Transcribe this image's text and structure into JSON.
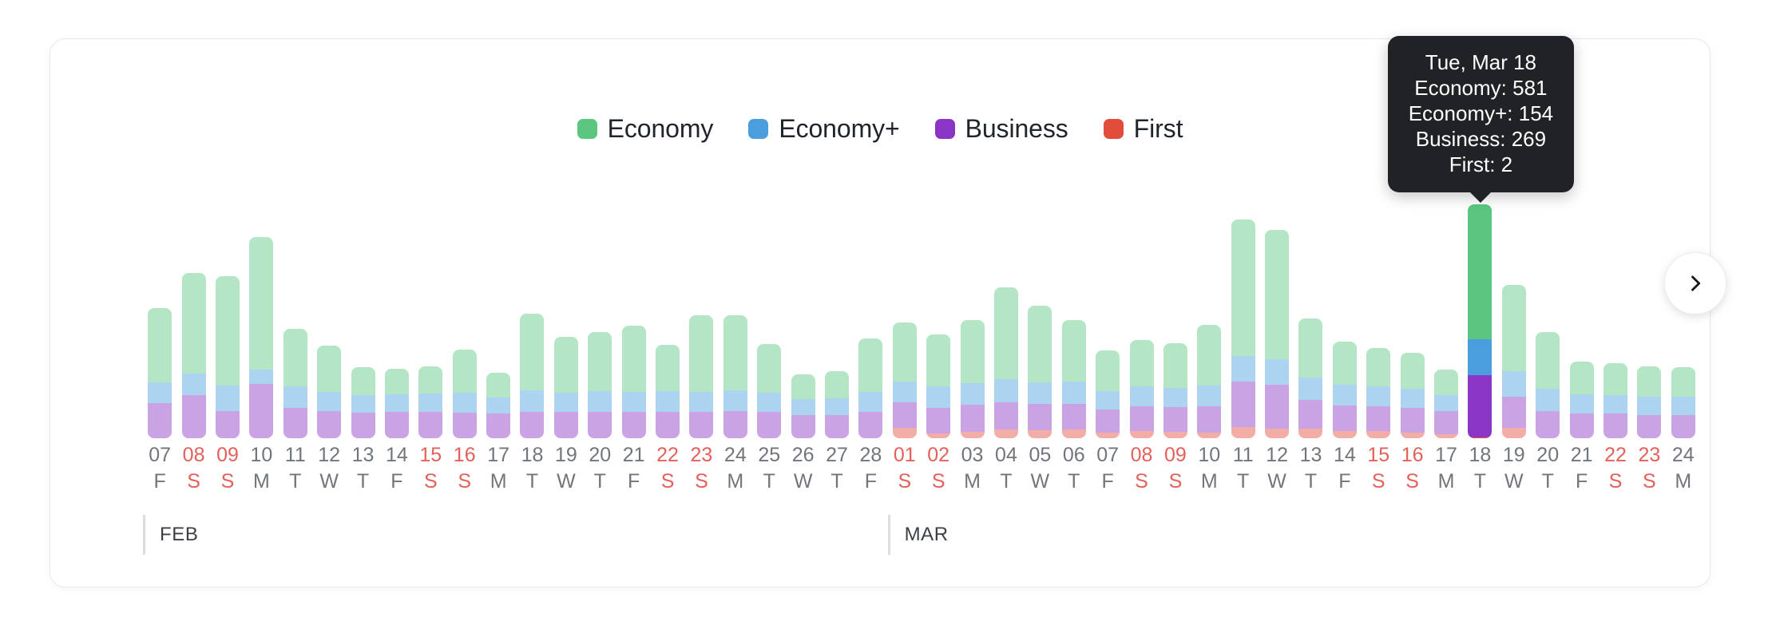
{
  "colors": {
    "economy": "#5bc67f",
    "economy_plus": "#4a9ede",
    "business": "#8b35c4",
    "first": "#e24c3b",
    "tooltip_bg": "#202226",
    "weekend_text": "#e4605a",
    "weekday_text": "#71757c",
    "card_bg": "#ffffff"
  },
  "legend": {
    "items": [
      {
        "label": "Economy",
        "color": "#5bc67f",
        "key": "economy"
      },
      {
        "label": "Economy+",
        "color": "#4a9ede",
        "key": "economy_plus"
      },
      {
        "label": "Business",
        "color": "#8b35c4",
        "key": "business"
      },
      {
        "label": "First",
        "color": "#e24c3b",
        "key": "first"
      }
    ]
  },
  "tooltip": {
    "date": "Tue, Mar 18",
    "rows": [
      "Economy: 581",
      "Economy+: 154",
      "Business: 269",
      "First: 2"
    ],
    "highlight_index": 39
  },
  "next_button": {
    "icon": "chevron-right-icon",
    "label": "Next"
  },
  "months": [
    {
      "label": "FEB",
      "start_index": 0,
      "span": 22
    },
    {
      "label": "MAR",
      "start_index": 22,
      "span": 24
    }
  ],
  "chart_data": {
    "type": "bar",
    "stacked": true,
    "title": "",
    "xlabel": "",
    "ylabel": "",
    "legend_position": "top-center",
    "grid": false,
    "series": [
      {
        "name": "Economy",
        "key": "economy",
        "color": "#5bc67f"
      },
      {
        "name": "Economy+",
        "key": "economy_plus",
        "color": "#4a9ede"
      },
      {
        "name": "Business",
        "key": "business",
        "color": "#8b35c4"
      },
      {
        "name": "First",
        "key": "first",
        "color": "#e24c3b"
      }
    ],
    "ymax": 1100,
    "categories": [
      {
        "day": "07",
        "dow": "F",
        "month": "FEB",
        "weekend": false,
        "economy": 322,
        "economy_plus": 90,
        "business": 150,
        "first": 0
      },
      {
        "day": "08",
        "dow": "S",
        "month": "FEB",
        "weekend": true,
        "economy": 430,
        "economy_plus": 95,
        "business": 185,
        "first": 0
      },
      {
        "day": "09",
        "dow": "S",
        "month": "FEB",
        "weekend": true,
        "economy": 470,
        "economy_plus": 110,
        "business": 118,
        "first": 0
      },
      {
        "day": "10",
        "dow": "M",
        "month": "FEB",
        "weekend": false,
        "economy": 570,
        "economy_plus": 60,
        "business": 235,
        "first": 0
      },
      {
        "day": "11",
        "dow": "T",
        "month": "FEB",
        "weekend": false,
        "economy": 245,
        "economy_plus": 95,
        "business": 130,
        "first": 0
      },
      {
        "day": "12",
        "dow": "W",
        "month": "FEB",
        "weekend": false,
        "economy": 200,
        "economy_plus": 80,
        "business": 118,
        "first": 0
      },
      {
        "day": "13",
        "dow": "T",
        "month": "FEB",
        "weekend": false,
        "economy": 120,
        "economy_plus": 75,
        "business": 110,
        "first": 0
      },
      {
        "day": "14",
        "dow": "F",
        "month": "FEB",
        "weekend": false,
        "economy": 110,
        "economy_plus": 78,
        "business": 112,
        "first": 0
      },
      {
        "day": "15",
        "dow": "S",
        "month": "FEB",
        "weekend": true,
        "economy": 118,
        "economy_plus": 80,
        "business": 112,
        "first": 0
      },
      {
        "day": "16",
        "dow": "S",
        "month": "FEB",
        "weekend": true,
        "economy": 185,
        "economy_plus": 85,
        "business": 110,
        "first": 0
      },
      {
        "day": "17",
        "dow": "M",
        "month": "FEB",
        "weekend": false,
        "economy": 105,
        "economy_plus": 72,
        "business": 105,
        "first": 0
      },
      {
        "day": "18",
        "dow": "T",
        "month": "FEB",
        "weekend": false,
        "economy": 330,
        "economy_plus": 90,
        "business": 115,
        "first": 0
      },
      {
        "day": "19",
        "dow": "W",
        "month": "FEB",
        "weekend": false,
        "economy": 240,
        "economy_plus": 85,
        "business": 112,
        "first": 0
      },
      {
        "day": "20",
        "dow": "T",
        "month": "FEB",
        "weekend": false,
        "economy": 255,
        "economy_plus": 88,
        "business": 115,
        "first": 0
      },
      {
        "day": "21",
        "dow": "F",
        "month": "FEB",
        "weekend": false,
        "economy": 285,
        "economy_plus": 88,
        "business": 112,
        "first": 0
      },
      {
        "day": "22",
        "dow": "S",
        "month": "FEB",
        "weekend": true,
        "economy": 200,
        "economy_plus": 88,
        "business": 115,
        "first": 0
      },
      {
        "day": "23",
        "dow": "S",
        "month": "FEB",
        "weekend": true,
        "economy": 330,
        "economy_plus": 85,
        "business": 115,
        "first": 0
      },
      {
        "day": "24",
        "dow": "M",
        "month": "FEB",
        "weekend": false,
        "economy": 320,
        "economy_plus": 90,
        "business": 118,
        "first": 0
      },
      {
        "day": "25",
        "dow": "T",
        "month": "FEB",
        "weekend": false,
        "economy": 210,
        "economy_plus": 85,
        "business": 112,
        "first": 0
      },
      {
        "day": "26",
        "dow": "W",
        "month": "FEB",
        "weekend": false,
        "economy": 105,
        "economy_plus": 70,
        "business": 100,
        "first": 0
      },
      {
        "day": "27",
        "dow": "T",
        "month": "FEB",
        "weekend": false,
        "economy": 118,
        "economy_plus": 72,
        "business": 100,
        "first": 0
      },
      {
        "day": "28",
        "dow": "F",
        "month": "FEB",
        "weekend": false,
        "economy": 230,
        "economy_plus": 85,
        "business": 115,
        "first": 0
      },
      {
        "day": "01",
        "dow": "S",
        "month": "MAR",
        "weekend": true,
        "economy": 255,
        "economy_plus": 90,
        "business": 110,
        "first": 45
      },
      {
        "day": "02",
        "dow": "S",
        "month": "MAR",
        "weekend": true,
        "economy": 225,
        "economy_plus": 90,
        "business": 112,
        "first": 20
      },
      {
        "day": "03",
        "dow": "M",
        "month": "MAR",
        "weekend": false,
        "economy": 270,
        "economy_plus": 95,
        "business": 115,
        "first": 28
      },
      {
        "day": "04",
        "dow": "T",
        "month": "MAR",
        "weekend": false,
        "economy": 395,
        "economy_plus": 100,
        "business": 118,
        "first": 38
      },
      {
        "day": "05",
        "dow": "W",
        "month": "MAR",
        "weekend": false,
        "economy": 330,
        "economy_plus": 95,
        "business": 112,
        "first": 35
      },
      {
        "day": "06",
        "dow": "T",
        "month": "MAR",
        "weekend": false,
        "economy": 265,
        "economy_plus": 95,
        "business": 110,
        "first": 38
      },
      {
        "day": "07",
        "dow": "F",
        "month": "MAR",
        "weekend": false,
        "economy": 175,
        "economy_plus": 78,
        "business": 100,
        "first": 25
      },
      {
        "day": "08",
        "dow": "S",
        "month": "MAR",
        "weekend": true,
        "economy": 200,
        "economy_plus": 85,
        "business": 108,
        "first": 30
      },
      {
        "day": "09",
        "dow": "S",
        "month": "MAR",
        "weekend": true,
        "economy": 190,
        "economy_plus": 85,
        "business": 105,
        "first": 28
      },
      {
        "day": "10",
        "dow": "M",
        "month": "MAR",
        "weekend": false,
        "economy": 260,
        "economy_plus": 90,
        "business": 112,
        "first": 25
      },
      {
        "day": "11",
        "dow": "T",
        "month": "MAR",
        "weekend": false,
        "economy": 590,
        "economy_plus": 110,
        "business": 195,
        "first": 48
      },
      {
        "day": "12",
        "dow": "W",
        "month": "MAR",
        "weekend": false,
        "economy": 555,
        "economy_plus": 110,
        "business": 190,
        "first": 42
      },
      {
        "day": "13",
        "dow": "T",
        "month": "MAR",
        "weekend": false,
        "economy": 255,
        "economy_plus": 95,
        "business": 125,
        "first": 40
      },
      {
        "day": "14",
        "dow": "F",
        "month": "MAR",
        "weekend": false,
        "economy": 185,
        "economy_plus": 88,
        "business": 110,
        "first": 32
      },
      {
        "day": "15",
        "dow": "S",
        "month": "MAR",
        "weekend": true,
        "economy": 165,
        "economy_plus": 85,
        "business": 108,
        "first": 30
      },
      {
        "day": "16",
        "dow": "S",
        "month": "MAR",
        "weekend": true,
        "economy": 155,
        "economy_plus": 82,
        "business": 105,
        "first": 25
      },
      {
        "day": "17",
        "dow": "M",
        "month": "MAR",
        "weekend": false,
        "economy": 110,
        "economy_plus": 70,
        "business": 98,
        "first": 18
      },
      {
        "day": "18",
        "dow": "T",
        "month": "MAR",
        "weekend": false,
        "economy": 581,
        "economy_plus": 154,
        "business": 269,
        "first": 2
      },
      {
        "day": "19",
        "dow": "W",
        "month": "MAR",
        "weekend": false,
        "economy": 370,
        "economy_plus": 110,
        "business": 135,
        "first": 45
      },
      {
        "day": "20",
        "dow": "T",
        "month": "MAR",
        "weekend": false,
        "economy": 245,
        "economy_plus": 95,
        "business": 118,
        "first": 0
      },
      {
        "day": "21",
        "dow": "F",
        "month": "MAR",
        "weekend": false,
        "economy": 140,
        "economy_plus": 85,
        "business": 105,
        "first": 0
      },
      {
        "day": "22",
        "dow": "S",
        "month": "MAR",
        "weekend": true,
        "economy": 135,
        "economy_plus": 82,
        "business": 105,
        "first": 0
      },
      {
        "day": "23",
        "dow": "S",
        "month": "MAR",
        "weekend": true,
        "economy": 130,
        "economy_plus": 80,
        "business": 100,
        "first": 0
      },
      {
        "day": "24",
        "dow": "M",
        "month": "MAR",
        "weekend": false,
        "economy": 125,
        "economy_plus": 80,
        "business": 100,
        "first": 0
      }
    ]
  }
}
